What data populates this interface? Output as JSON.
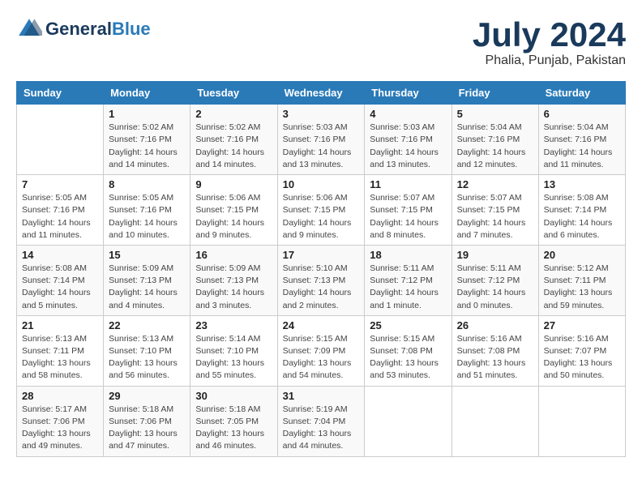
{
  "header": {
    "logo_general": "General",
    "logo_blue": "Blue",
    "month_year": "July 2024",
    "location": "Phalia, Punjab, Pakistan"
  },
  "weekdays": [
    "Sunday",
    "Monday",
    "Tuesday",
    "Wednesday",
    "Thursday",
    "Friday",
    "Saturday"
  ],
  "weeks": [
    [
      {
        "day": "",
        "info": ""
      },
      {
        "day": "1",
        "info": "Sunrise: 5:02 AM\nSunset: 7:16 PM\nDaylight: 14 hours\nand 14 minutes."
      },
      {
        "day": "2",
        "info": "Sunrise: 5:02 AM\nSunset: 7:16 PM\nDaylight: 14 hours\nand 14 minutes."
      },
      {
        "day": "3",
        "info": "Sunrise: 5:03 AM\nSunset: 7:16 PM\nDaylight: 14 hours\nand 13 minutes."
      },
      {
        "day": "4",
        "info": "Sunrise: 5:03 AM\nSunset: 7:16 PM\nDaylight: 14 hours\nand 13 minutes."
      },
      {
        "day": "5",
        "info": "Sunrise: 5:04 AM\nSunset: 7:16 PM\nDaylight: 14 hours\nand 12 minutes."
      },
      {
        "day": "6",
        "info": "Sunrise: 5:04 AM\nSunset: 7:16 PM\nDaylight: 14 hours\nand 11 minutes."
      }
    ],
    [
      {
        "day": "7",
        "info": "Sunrise: 5:05 AM\nSunset: 7:16 PM\nDaylight: 14 hours\nand 11 minutes."
      },
      {
        "day": "8",
        "info": "Sunrise: 5:05 AM\nSunset: 7:16 PM\nDaylight: 14 hours\nand 10 minutes."
      },
      {
        "day": "9",
        "info": "Sunrise: 5:06 AM\nSunset: 7:15 PM\nDaylight: 14 hours\nand 9 minutes."
      },
      {
        "day": "10",
        "info": "Sunrise: 5:06 AM\nSunset: 7:15 PM\nDaylight: 14 hours\nand 9 minutes."
      },
      {
        "day": "11",
        "info": "Sunrise: 5:07 AM\nSunset: 7:15 PM\nDaylight: 14 hours\nand 8 minutes."
      },
      {
        "day": "12",
        "info": "Sunrise: 5:07 AM\nSunset: 7:15 PM\nDaylight: 14 hours\nand 7 minutes."
      },
      {
        "day": "13",
        "info": "Sunrise: 5:08 AM\nSunset: 7:14 PM\nDaylight: 14 hours\nand 6 minutes."
      }
    ],
    [
      {
        "day": "14",
        "info": "Sunrise: 5:08 AM\nSunset: 7:14 PM\nDaylight: 14 hours\nand 5 minutes."
      },
      {
        "day": "15",
        "info": "Sunrise: 5:09 AM\nSunset: 7:13 PM\nDaylight: 14 hours\nand 4 minutes."
      },
      {
        "day": "16",
        "info": "Sunrise: 5:09 AM\nSunset: 7:13 PM\nDaylight: 14 hours\nand 3 minutes."
      },
      {
        "day": "17",
        "info": "Sunrise: 5:10 AM\nSunset: 7:13 PM\nDaylight: 14 hours\nand 2 minutes."
      },
      {
        "day": "18",
        "info": "Sunrise: 5:11 AM\nSunset: 7:12 PM\nDaylight: 14 hours\nand 1 minute."
      },
      {
        "day": "19",
        "info": "Sunrise: 5:11 AM\nSunset: 7:12 PM\nDaylight: 14 hours\nand 0 minutes."
      },
      {
        "day": "20",
        "info": "Sunrise: 5:12 AM\nSunset: 7:11 PM\nDaylight: 13 hours\nand 59 minutes."
      }
    ],
    [
      {
        "day": "21",
        "info": "Sunrise: 5:13 AM\nSunset: 7:11 PM\nDaylight: 13 hours\nand 58 minutes."
      },
      {
        "day": "22",
        "info": "Sunrise: 5:13 AM\nSunset: 7:10 PM\nDaylight: 13 hours\nand 56 minutes."
      },
      {
        "day": "23",
        "info": "Sunrise: 5:14 AM\nSunset: 7:10 PM\nDaylight: 13 hours\nand 55 minutes."
      },
      {
        "day": "24",
        "info": "Sunrise: 5:15 AM\nSunset: 7:09 PM\nDaylight: 13 hours\nand 54 minutes."
      },
      {
        "day": "25",
        "info": "Sunrise: 5:15 AM\nSunset: 7:08 PM\nDaylight: 13 hours\nand 53 minutes."
      },
      {
        "day": "26",
        "info": "Sunrise: 5:16 AM\nSunset: 7:08 PM\nDaylight: 13 hours\nand 51 minutes."
      },
      {
        "day": "27",
        "info": "Sunrise: 5:16 AM\nSunset: 7:07 PM\nDaylight: 13 hours\nand 50 minutes."
      }
    ],
    [
      {
        "day": "28",
        "info": "Sunrise: 5:17 AM\nSunset: 7:06 PM\nDaylight: 13 hours\nand 49 minutes."
      },
      {
        "day": "29",
        "info": "Sunrise: 5:18 AM\nSunset: 7:06 PM\nDaylight: 13 hours\nand 47 minutes."
      },
      {
        "day": "30",
        "info": "Sunrise: 5:18 AM\nSunset: 7:05 PM\nDaylight: 13 hours\nand 46 minutes."
      },
      {
        "day": "31",
        "info": "Sunrise: 5:19 AM\nSunset: 7:04 PM\nDaylight: 13 hours\nand 44 minutes."
      },
      {
        "day": "",
        "info": ""
      },
      {
        "day": "",
        "info": ""
      },
      {
        "day": "",
        "info": ""
      }
    ]
  ]
}
